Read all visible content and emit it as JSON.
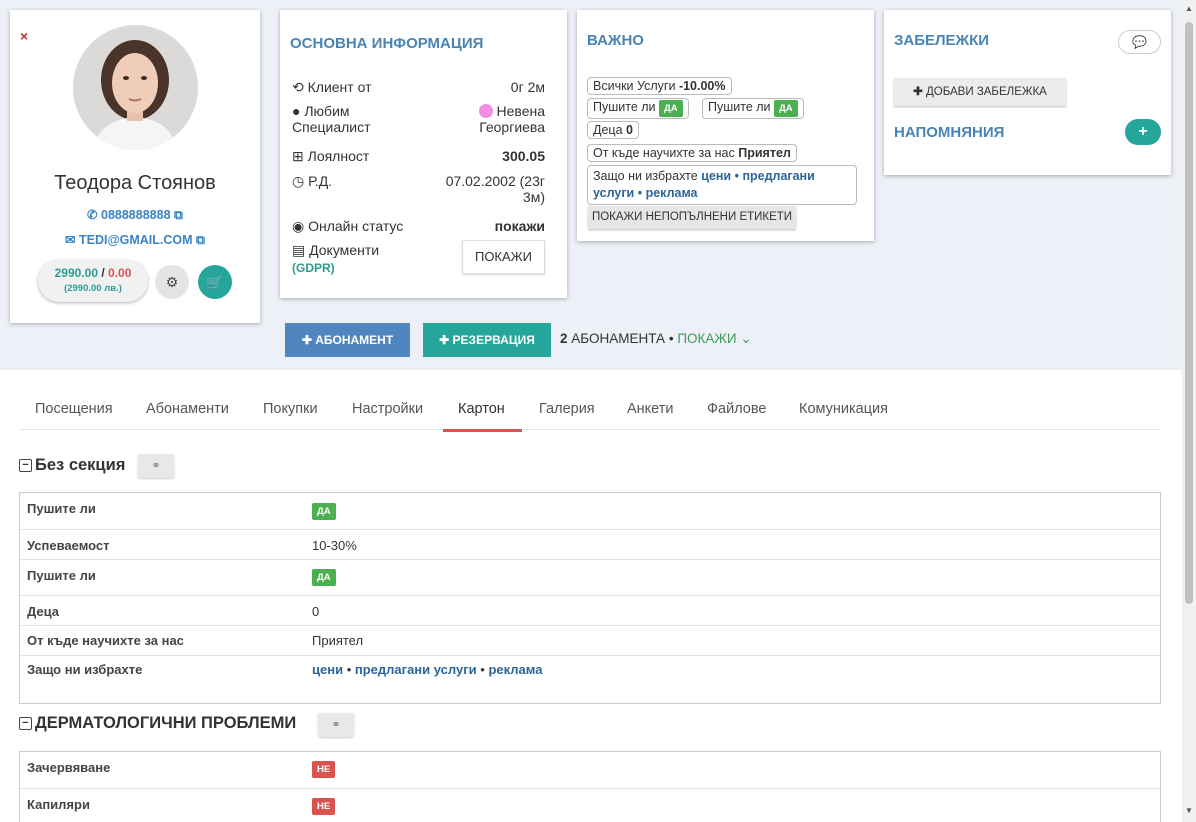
{
  "profile": {
    "close_icon": "×",
    "name": "Теодора Стоянов",
    "phone": "0888888888",
    "email": "TEDI@GMAIL.COM",
    "balance_paid": "2990.00",
    "balance_sep": " / ",
    "balance_due": "0.00",
    "balance_sub": "(2990.00 лв.)"
  },
  "basic_info": {
    "title": "ОСНОВНА ИНФОРМАЦИЯ",
    "client_since_label": "Клиент от",
    "client_since_value": "0г 2м",
    "favorite_label_1": "Любим",
    "favorite_label_2": "Специалист",
    "favorite_value_1": "Невена",
    "favorite_value_2": "Георгиева",
    "loyalty_label": "Лоялност",
    "loyalty_value": "300.05",
    "dob_label": "Р.Д.",
    "dob_value_1": "07.02.2002 (23г",
    "dob_value_2": "3м)",
    "online_label": "Онлайн статус",
    "online_value": "покажи",
    "documents_label": "Документи",
    "documents_sub": "(GDPR)",
    "show_button": "ПОКАЖИ"
  },
  "important": {
    "title": "ВАЖНО",
    "all_services_label": "Всички Услуги",
    "all_services_value": "-10.00%",
    "smoke_label": "Пушите ли",
    "yes": "ДА",
    "children_label": "Деца",
    "children_value": "0",
    "source_label": "От къде научихте за нас",
    "source_value": "Приятел",
    "why_label": "Защо ни избрахте",
    "why_value_1": "цени",
    "why_value_2": "предлагани",
    "why_value_3": "услуги",
    "why_value_4": "реклама",
    "dot": "•",
    "show_empty_button": "ПОКАЖИ НЕПОПЪЛНЕНИ ЕТИКЕТИ"
  },
  "notes": {
    "title": "ЗАБЕЛЕЖКИ",
    "add_note_button": "ДОБАВИ ЗАБЕЛЕЖКА",
    "reminders_title": "НАПОМНЯНИЯ",
    "plus": "+"
  },
  "actions": {
    "subscription_button": "АБОНАМЕНТ",
    "reservation_button": "РЕЗЕРВАЦИЯ",
    "subs_count": "2",
    "subs_label": "АБОНАМЕНТА",
    "subs_dot": "•",
    "subs_show": "ПОКАЖИ"
  },
  "tabs": [
    {
      "label": "Посещения"
    },
    {
      "label": "Абонаменти"
    },
    {
      "label": "Покупки"
    },
    {
      "label": "Настройки"
    },
    {
      "label": "Картон"
    },
    {
      "label": "Галерия"
    },
    {
      "label": "Анкети"
    },
    {
      "label": "Файлове"
    },
    {
      "label": "Комуникация"
    }
  ],
  "active_tab": "Картон",
  "sections": [
    {
      "title": "Без секция",
      "rows": [
        {
          "key": "Пушите ли",
          "badge": "ДА"
        },
        {
          "key": "Успеваемост",
          "value": "10-30%"
        },
        {
          "key": "Пушите ли",
          "badge": "ДА"
        },
        {
          "key": "Деца",
          "value": "0"
        },
        {
          "key": "От къде научихте за нас",
          "value": "Приятел"
        },
        {
          "key": "Защо ни избрахте",
          "links": [
            "цени",
            "предлагани услуги",
            "реклама"
          ]
        }
      ]
    },
    {
      "title": "ДЕРМАТОЛОГИЧНИ ПРОБЛЕМИ",
      "rows": [
        {
          "key": "Зачервяване",
          "badge": "НЕ"
        },
        {
          "key": "Капиляри",
          "badge": "НЕ"
        }
      ]
    }
  ],
  "colors": {
    "accent_blue": "#4a84b5",
    "teal": "#26a69a",
    "green_badge": "#4caf50",
    "red_badge": "#d9534f",
    "tab_underline": "#d9534f"
  }
}
